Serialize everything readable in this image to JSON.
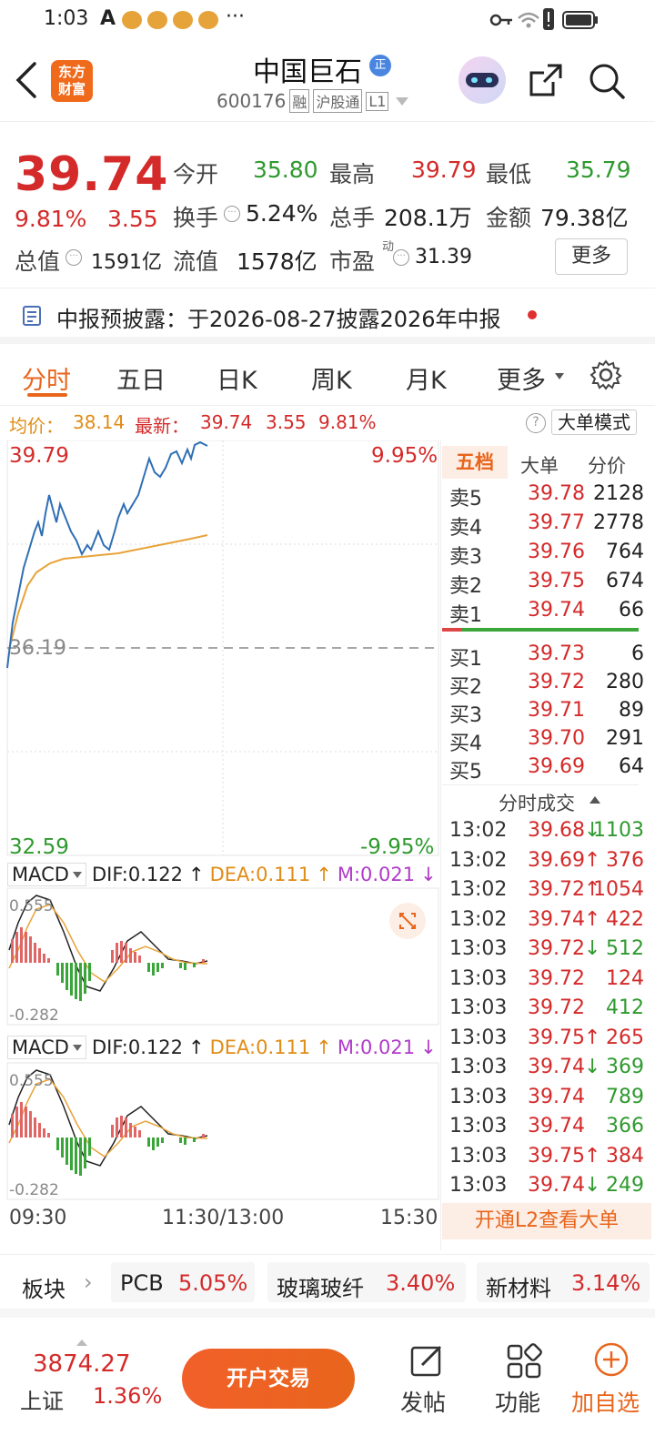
{
  "status": {
    "time": "1:03",
    "letter": "A",
    "more": "···"
  },
  "header": {
    "logo": "东方\n财富",
    "logo_l1": "东方",
    "logo_l2": "财富",
    "stock_name": "中国巨石",
    "badge": "正",
    "code": "600176",
    "tag_margin": "融",
    "tag_connect": "沪股通",
    "tag_level": "L1"
  },
  "quote": {
    "price": "39.74",
    "pct": "9.81%",
    "chg": "3.55",
    "open_label": "今开",
    "open": "35.80",
    "high_label": "最高",
    "high": "39.79",
    "low_label": "最低",
    "low": "35.79",
    "turnover_label": "换手",
    "turnover": "5.24%",
    "vol_label": "总手",
    "vol": "208.1万",
    "amount_label": "金额",
    "amount": "79.38亿",
    "mcap_label": "总值",
    "mcap": "1591亿",
    "float_label": "流值",
    "float": "1578亿",
    "pe_label": "市盈",
    "pe_sup": "动",
    "pe": "31.39",
    "more_btn": "更多"
  },
  "notice": {
    "text": "中报预披露：于2026-08-27披露2026年中报"
  },
  "tabs": [
    "分时",
    "五日",
    "日K",
    "周K",
    "月K",
    "更多"
  ],
  "chart": {
    "avg_label": "均价：",
    "avg": "38.14",
    "latest_label": "最新：",
    "latest": "39.74",
    "chg": "3.55",
    "pct": "9.81%",
    "mode_btn": "大单模式",
    "ymax": "39.79",
    "ymin": "32.59",
    "pmax": "9.95%",
    "pmin": "-9.95%",
    "base": "36.19",
    "t1": "09:30",
    "t2": "11:30/13:00",
    "t3": "15:30"
  },
  "macd": {
    "name": "MACD",
    "dif": "DIF:0.122",
    "dea": "DEA:0.111",
    "m": "M:0.021",
    "top": "0.555",
    "bot": "-0.282"
  },
  "book": {
    "tab_active": "五档",
    "tab2": "大单",
    "tab3": "分价",
    "asks": [
      {
        "l": "卖5",
        "p": "39.78",
        "v": "2128"
      },
      {
        "l": "卖4",
        "p": "39.77",
        "v": "2778"
      },
      {
        "l": "卖3",
        "p": "39.76",
        "v": "764"
      },
      {
        "l": "卖2",
        "p": "39.75",
        "v": "674"
      },
      {
        "l": "卖1",
        "p": "39.74",
        "v": "66"
      }
    ],
    "bids": [
      {
        "l": "买1",
        "p": "39.73",
        "v": "6"
      },
      {
        "l": "买2",
        "p": "39.72",
        "v": "280"
      },
      {
        "l": "买3",
        "p": "39.71",
        "v": "89"
      },
      {
        "l": "买4",
        "p": "39.70",
        "v": "291"
      },
      {
        "l": "买5",
        "p": "39.69",
        "v": "64"
      }
    ]
  },
  "ticks": {
    "title": "分时成交",
    "rows": [
      {
        "t": "13:02",
        "p": "39.68",
        "a": "↓",
        "v": "1103",
        "c": "green"
      },
      {
        "t": "13:02",
        "p": "39.69",
        "a": "↑",
        "v": "376",
        "c": "red"
      },
      {
        "t": "13:02",
        "p": "39.72",
        "a": "↑",
        "v": "1054",
        "c": "red"
      },
      {
        "t": "13:02",
        "p": "39.74",
        "a": "↑",
        "v": "422",
        "c": "red"
      },
      {
        "t": "13:03",
        "p": "39.72",
        "a": "↓",
        "v": "512",
        "c": "green"
      },
      {
        "t": "13:03",
        "p": "39.72",
        "a": "",
        "v": "124",
        "c": "red"
      },
      {
        "t": "13:03",
        "p": "39.72",
        "a": "",
        "v": "412",
        "c": "green"
      },
      {
        "t": "13:03",
        "p": "39.75",
        "a": "↑",
        "v": "265",
        "c": "red"
      },
      {
        "t": "13:03",
        "p": "39.74",
        "a": "↓",
        "v": "369",
        "c": "green"
      },
      {
        "t": "13:03",
        "p": "39.74",
        "a": "",
        "v": "789",
        "c": "green"
      },
      {
        "t": "13:03",
        "p": "39.74",
        "a": "",
        "v": "366",
        "c": "green"
      },
      {
        "t": "13:03",
        "p": "39.75",
        "a": "↑",
        "v": "384",
        "c": "red"
      },
      {
        "t": "13:03",
        "p": "39.74",
        "a": "↓",
        "v": "249",
        "c": "green"
      }
    ],
    "l2_btn": "开通L2查看大单"
  },
  "sectors": {
    "label": "板块",
    "items": [
      {
        "n": "PCB",
        "v": "5.05%"
      },
      {
        "n": "玻璃玻纤",
        "v": "3.40%"
      },
      {
        "n": "新材料",
        "v": "3.14%"
      }
    ]
  },
  "bottom": {
    "index_val": "3874.27",
    "index_name": "上证",
    "index_pct": "1.36%",
    "trade_btn": "开户交易",
    "post": "发帖",
    "func": "功能",
    "add": "加自选"
  },
  "colors": {
    "up": "#d42a2a",
    "down": "#2f9a2f",
    "accent": "#e8651c",
    "avg_line": "#e8a33a",
    "price_line": "#2f6fb5"
  }
}
